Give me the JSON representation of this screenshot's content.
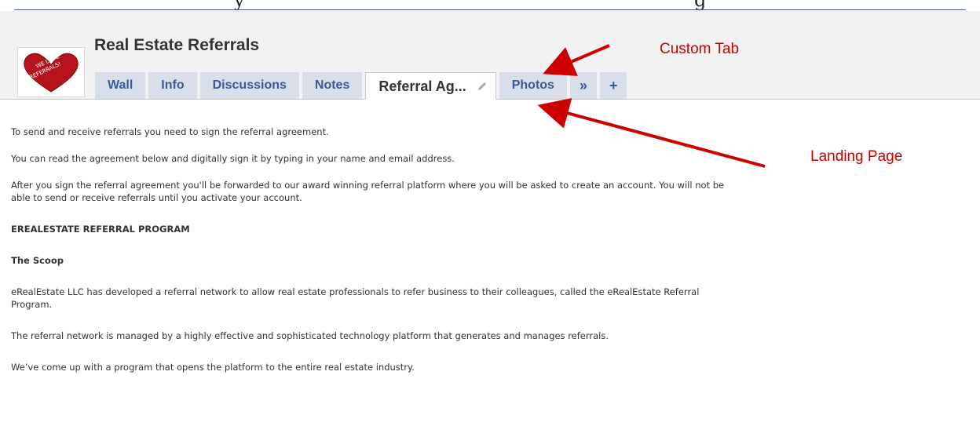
{
  "top_caption": {
    "left_text": "y",
    "right_text": "g"
  },
  "page": {
    "title": "Real Estate Referrals",
    "logo_alt": "WE LOVE REFERRALS!"
  },
  "tabs": [
    {
      "label": "Wall"
    },
    {
      "label": "Info"
    },
    {
      "label": "Discussions"
    },
    {
      "label": "Notes"
    },
    {
      "label": "Referral Ag...",
      "active": true
    },
    {
      "label": "Photos"
    },
    {
      "label": "»"
    },
    {
      "label": "+"
    }
  ],
  "annotations": {
    "custom_tab": "Custom Tab",
    "landing_page": "Landing Page"
  },
  "content": {
    "p1": "To send and receive referrals you need to sign the referral agreement.",
    "p2": "You can read the agreement below and digitally sign it by typing in your name and email address.",
    "p3_line1": "After you sign the referral agreement you'll be forwarded to our award winning referral platform where you will be asked to create an account. You will not be",
    "p3_line2": "able to send or receive referrals until you activate your account.",
    "heading_program": "EREALESTATE REFERRAL PROGRAM",
    "heading_scoop": "The Scoop",
    "p4_line1": "eRealEstate LLC has developed a referral network to allow real estate professionals to refer business to their colleagues, called the eRealEstate Referral",
    "p4_line2": "Program.",
    "p5": "The referral network is managed by a highly effective and sophisticated technology platform that generates and manages referrals.",
    "p6": "We’ve come up with a program that opens the platform to the entire real estate industry."
  },
  "colors": {
    "tab_bg": "#d8dfea",
    "tab_text": "#3b5998",
    "annotation": "#cc0000",
    "header_bg": "#f2f2f2"
  },
  "icons": [
    "heart-logo",
    "pencil-icon",
    "double-chevron-icon",
    "plus-icon"
  ]
}
